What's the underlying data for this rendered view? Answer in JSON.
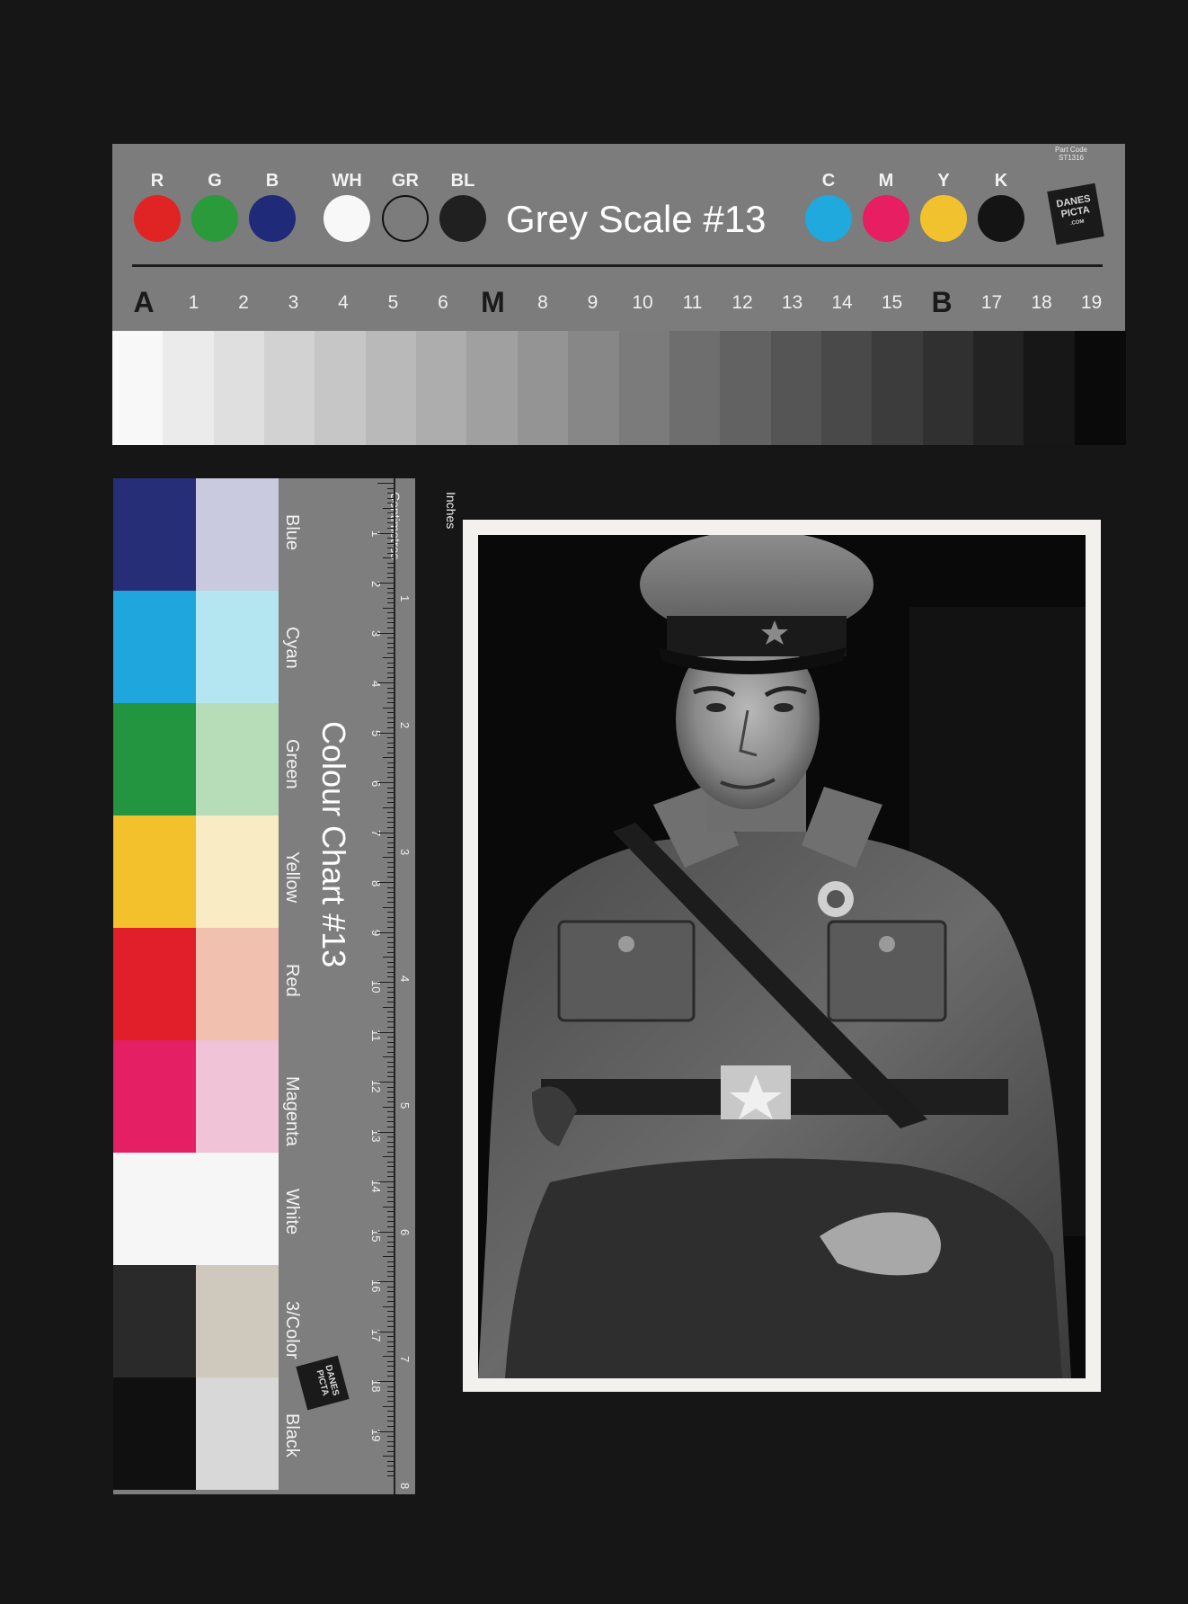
{
  "grey_scale_card": {
    "part_code": "Part Code ST1316",
    "title": "Grey Scale #13",
    "logo_text": "DANES PICTA",
    "logo_sub": ".COM",
    "color_swatches": [
      {
        "label": "R",
        "color": "#e02424"
      },
      {
        "label": "G",
        "color": "#2a9a3a"
      },
      {
        "label": "B",
        "color": "#1f2a78"
      },
      {
        "label": "WH",
        "color": "#f8f8f8"
      },
      {
        "label": "GR",
        "color": "#7c7c7c"
      },
      {
        "label": "BL",
        "color": "#202020"
      },
      {
        "label": "C",
        "color": "#1fa9dd"
      },
      {
        "label": "M",
        "color": "#e81e63"
      },
      {
        "label": "Y",
        "color": "#f2c12e"
      },
      {
        "label": "K",
        "color": "#141414"
      }
    ],
    "step_labels": [
      "A",
      "1",
      "2",
      "3",
      "4",
      "5",
      "6",
      "M",
      "8",
      "9",
      "10",
      "11",
      "12",
      "13",
      "14",
      "15",
      "B",
      "17",
      "18",
      "19"
    ]
  },
  "colour_chart": {
    "title": "Colour Chart #13",
    "ruler_unit_inches": "Inches",
    "ruler_unit_cm": "Centimetres",
    "logo_text": "DANES PICTA",
    "logo_sub": ".COM",
    "patches": [
      {
        "name": "Blue",
        "dark": "#262e77",
        "light": "#c9c9df"
      },
      {
        "name": "Cyan",
        "dark": "#1fa6dc",
        "light": "#b3e6f0"
      },
      {
        "name": "Green",
        "dark": "#23943f",
        "light": "#b7ddb8"
      },
      {
        "name": "Yellow",
        "dark": "#f2c12b",
        "light": "#f9ebc3"
      },
      {
        "name": "Red",
        "dark": "#e01f2b",
        "light": "#f2c0ae"
      },
      {
        "name": "Magenta",
        "dark": "#e51f63",
        "light": "#f0c3d6"
      },
      {
        "name": "White",
        "dark": "#f6f6f6",
        "light": "#f6f6f6"
      },
      {
        "name": "3/Color",
        "dark": "#2a2a2a",
        "light": "#cfc8bc"
      },
      {
        "name": "Black",
        "dark": "#101010",
        "light": "#d8d8d8"
      }
    ],
    "cm_marks": [
      "1",
      "2",
      "3",
      "4",
      "5",
      "6",
      "7",
      "8",
      "9",
      "10",
      "11",
      "12",
      "13",
      "14",
      "15",
      "16",
      "17",
      "18",
      "19"
    ],
    "inch_marks": [
      "1",
      "2",
      "3",
      "4",
      "5",
      "6",
      "7",
      "8"
    ]
  }
}
